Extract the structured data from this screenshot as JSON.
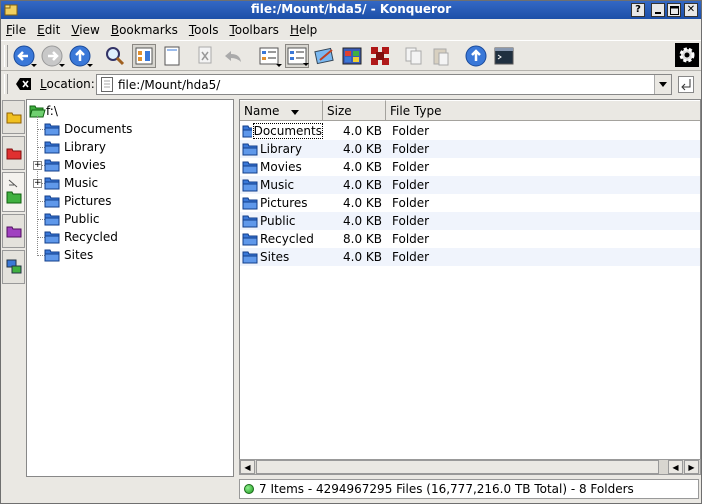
{
  "window": {
    "title": "file:/Mount/hda5/ - Konqueror"
  },
  "titlebar_buttons": [
    "?",
    "",
    "",
    "✕"
  ],
  "menu": [
    {
      "label": "File",
      "accel": "F",
      "rest": "ile"
    },
    {
      "label": "Edit",
      "accel": "E",
      "rest": "dit"
    },
    {
      "label": "View",
      "accel": "V",
      "rest": "iew"
    },
    {
      "label": "Bookmarks",
      "accel": "B",
      "rest": "ookmarks"
    },
    {
      "label": "Tools",
      "accel": "T",
      "rest": "ools"
    },
    {
      "label": "Toolbars",
      "accel": "T",
      "rest": "oolbars"
    },
    {
      "label": "Help",
      "accel": "H",
      "rest": "elp"
    }
  ],
  "toolbar": {
    "icons": [
      "back-icon",
      "forward-icon",
      "up-icon",
      "find-icon",
      "icon-view-icon",
      "new-window-icon",
      "cut-icon",
      "undo-icon",
      "detailed-view-icon",
      "multicolumn-view-icon",
      "image-viewer-icon",
      "windows-icon",
      "office-icon",
      "copy-icon",
      "paste-icon",
      "home-icon",
      "terminal-icon",
      "gear-icon"
    ]
  },
  "location": {
    "label_accel": "L",
    "label_rest": "ocation:",
    "value": "file:/Mount/hda5/"
  },
  "tree": {
    "root": "f:\\",
    "items": [
      {
        "label": "Documents",
        "expandable": false
      },
      {
        "label": "Library",
        "expandable": false
      },
      {
        "label": "Movies",
        "expandable": true
      },
      {
        "label": "Music",
        "expandable": true
      },
      {
        "label": "Pictures",
        "expandable": false
      },
      {
        "label": "Public",
        "expandable": false
      },
      {
        "label": "Recycled",
        "expandable": false
      },
      {
        "label": "Sites",
        "expandable": false
      }
    ]
  },
  "list": {
    "columns": [
      "Name",
      "Size",
      "File Type"
    ],
    "rows": [
      {
        "name": "Documents",
        "size": "4.0 KB",
        "type": "Folder"
      },
      {
        "name": "Library",
        "size": "4.0 KB",
        "type": "Folder"
      },
      {
        "name": "Movies",
        "size": "4.0 KB",
        "type": "Folder"
      },
      {
        "name": "Music",
        "size": "4.0 KB",
        "type": "Folder"
      },
      {
        "name": "Pictures",
        "size": "4.0 KB",
        "type": "Folder"
      },
      {
        "name": "Public",
        "size": "4.0 KB",
        "type": "Folder"
      },
      {
        "name": "Recycled",
        "size": "8.0 KB",
        "type": "Folder"
      },
      {
        "name": "Sites",
        "size": "4.0 KB",
        "type": "Folder"
      }
    ]
  },
  "status": {
    "text": "7 Items - 4294967295 Files (16,777,216.0 TB Total) - 8 Folders"
  },
  "colors": {
    "titlebar": "#1c4fa8",
    "folder": "#3a78d8",
    "row_alt": "#f0f4fc"
  }
}
